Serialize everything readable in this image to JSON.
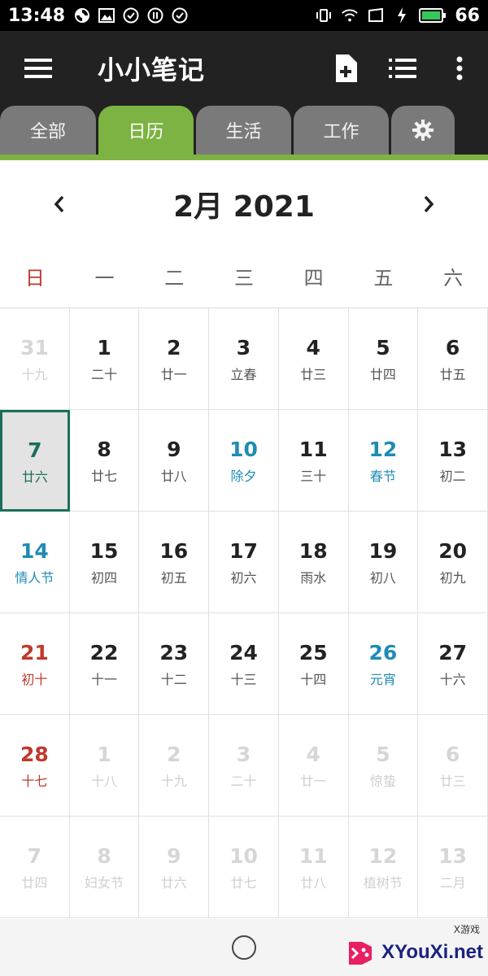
{
  "status_bar": {
    "time": "13:48",
    "battery_level": "66",
    "left_icons": [
      "sync-icon",
      "image-icon",
      "check-circle-icon",
      "pause-circle-icon",
      "check-circle-icon"
    ],
    "right_icons": [
      "vibrate-icon",
      "wifi-icon",
      "screen-icon",
      "charging-icon",
      "battery-icon"
    ]
  },
  "app_bar": {
    "title": "小小笔记",
    "actions": [
      "new-note-icon",
      "list-icon",
      "more-vertical-icon"
    ]
  },
  "tabs": [
    {
      "label": "全部",
      "active": false
    },
    {
      "label": "日历",
      "active": true
    },
    {
      "label": "生活",
      "active": false
    },
    {
      "label": "工作",
      "active": false
    },
    {
      "label": "",
      "icon": "gear-icon",
      "active": false
    }
  ],
  "calendar": {
    "month_label": "2月 2021",
    "weekdays": [
      "日",
      "一",
      "二",
      "三",
      "四",
      "五",
      "六"
    ],
    "weeks": [
      [
        {
          "num": "31",
          "lunar": "十九",
          "other": true
        },
        {
          "num": "1",
          "lunar": "二十"
        },
        {
          "num": "2",
          "lunar": "廿一"
        },
        {
          "num": "3",
          "lunar": "立春"
        },
        {
          "num": "4",
          "lunar": "廿三"
        },
        {
          "num": "5",
          "lunar": "廿四"
        },
        {
          "num": "6",
          "lunar": "廿五"
        }
      ],
      [
        {
          "num": "7",
          "lunar": "廿六",
          "today": true
        },
        {
          "num": "8",
          "lunar": "廿七"
        },
        {
          "num": "9",
          "lunar": "廿八"
        },
        {
          "num": "10",
          "lunar": "除夕",
          "festival": true
        },
        {
          "num": "11",
          "lunar": "三十"
        },
        {
          "num": "12",
          "lunar": "春节",
          "festival": true
        },
        {
          "num": "13",
          "lunar": "初二"
        }
      ],
      [
        {
          "num": "14",
          "lunar": "情人节",
          "festival": true
        },
        {
          "num": "15",
          "lunar": "初四"
        },
        {
          "num": "16",
          "lunar": "初五"
        },
        {
          "num": "17",
          "lunar": "初六"
        },
        {
          "num": "18",
          "lunar": "雨水"
        },
        {
          "num": "19",
          "lunar": "初八"
        },
        {
          "num": "20",
          "lunar": "初九"
        }
      ],
      [
        {
          "num": "21",
          "lunar": "初十",
          "sunday": true
        },
        {
          "num": "22",
          "lunar": "十一"
        },
        {
          "num": "23",
          "lunar": "十二"
        },
        {
          "num": "24",
          "lunar": "十三"
        },
        {
          "num": "25",
          "lunar": "十四"
        },
        {
          "num": "26",
          "lunar": "元宵",
          "festival": true
        },
        {
          "num": "27",
          "lunar": "十六"
        }
      ],
      [
        {
          "num": "28",
          "lunar": "十七",
          "sunday": true
        },
        {
          "num": "1",
          "lunar": "十八",
          "other": true
        },
        {
          "num": "2",
          "lunar": "十九",
          "other": true
        },
        {
          "num": "3",
          "lunar": "二十",
          "other": true
        },
        {
          "num": "4",
          "lunar": "廿一",
          "other": true
        },
        {
          "num": "5",
          "lunar": "惊蛰",
          "other": true
        },
        {
          "num": "6",
          "lunar": "廿三",
          "other": true
        }
      ],
      [
        {
          "num": "7",
          "lunar": "廿四",
          "other": true
        },
        {
          "num": "8",
          "lunar": "妇女节",
          "other": true
        },
        {
          "num": "9",
          "lunar": "廿六",
          "other": true
        },
        {
          "num": "10",
          "lunar": "廿七",
          "other": true
        },
        {
          "num": "11",
          "lunar": "廿八",
          "other": true
        },
        {
          "num": "12",
          "lunar": "植树节",
          "other": true
        },
        {
          "num": "13",
          "lunar": "二月",
          "other": true
        }
      ]
    ]
  },
  "watermark": {
    "text": "XYouXi.net",
    "small": "X游戏"
  },
  "colors": {
    "accent": "#7cb342",
    "today_border": "#1b6f5c",
    "festival": "#1f8bb5",
    "sunday": "#c0392b",
    "bar": "#222222"
  }
}
